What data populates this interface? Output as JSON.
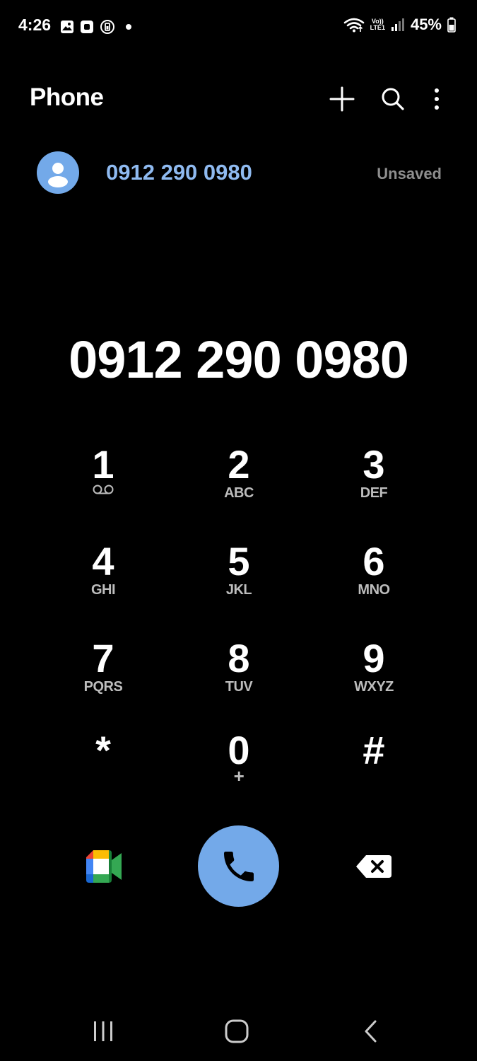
{
  "status_bar": {
    "time": "4:26",
    "volte_top": "Vo))",
    "volte_bottom": "LTE1",
    "battery": "45%",
    "icons": [
      "gallery-icon",
      "app-icon",
      "battery-saver-icon",
      "notification-dot-icon",
      "wifi-icon",
      "volte-icon",
      "signal-icon",
      "battery-icon"
    ]
  },
  "header": {
    "title": "Phone",
    "icons": [
      "add-icon",
      "search-icon",
      "more-options-icon"
    ]
  },
  "suggestion": {
    "number": "0912 290 0980",
    "status": "Unsaved",
    "avatar_color": "#73a9e9",
    "number_color": "#8fbaf0"
  },
  "dialed_number": "0912 290 0980",
  "keypad": {
    "keys": [
      {
        "digit": "1",
        "sub": ""
      },
      {
        "digit": "2",
        "sub": "ABC"
      },
      {
        "digit": "3",
        "sub": "DEF"
      },
      {
        "digit": "4",
        "sub": "GHI"
      },
      {
        "digit": "5",
        "sub": "JKL"
      },
      {
        "digit": "6",
        "sub": "MNO"
      },
      {
        "digit": "7",
        "sub": "PQRS"
      },
      {
        "digit": "8",
        "sub": "TUV"
      },
      {
        "digit": "9",
        "sub": "WXYZ"
      },
      {
        "digit": "*",
        "sub": ""
      },
      {
        "digit": "0",
        "sub": "+"
      },
      {
        "digit": "#",
        "sub": ""
      }
    ]
  },
  "actions": {
    "icons": [
      "google-meet-icon",
      "phone-call-icon",
      "backspace-icon"
    ],
    "call_color": "#73a9e9"
  },
  "nav_bar": {
    "icons": [
      "recent-apps-icon",
      "home-icon",
      "back-icon"
    ]
  }
}
